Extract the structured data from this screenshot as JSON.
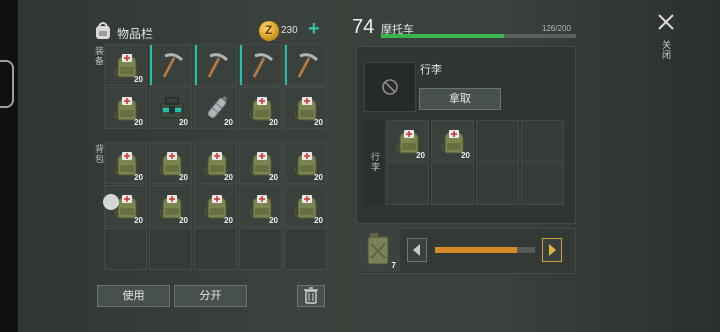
{
  "inventory": {
    "title": "物品栏",
    "coins": "230",
    "coin_glyph": "Z",
    "plus": "+",
    "side_label_top": "装备",
    "side_label_backpack": "背包",
    "use_label": "使用",
    "split_label": "分开",
    "equip_slots": [
      {
        "item": "backpack-icon",
        "qty": "20"
      },
      {
        "item": "pickaxe-icon",
        "qty": ""
      },
      {
        "item": "pickaxe-icon",
        "qty": ""
      },
      {
        "item": "pickaxe-icon",
        "qty": ""
      },
      {
        "item": "pickaxe-icon",
        "qty": ""
      },
      {
        "item": "backpack-icon",
        "qty": "20"
      },
      {
        "item": "toolbox-icon",
        "qty": "20"
      },
      {
        "item": "bottle-icon",
        "qty": "20"
      },
      {
        "item": "backpack-icon",
        "qty": "20"
      },
      {
        "item": "backpack-icon",
        "qty": "20"
      }
    ],
    "backpack_slots": [
      {
        "item": "backpack-icon",
        "qty": "20"
      },
      {
        "item": "backpack-icon",
        "qty": "20"
      },
      {
        "item": "backpack-icon",
        "qty": "20"
      },
      {
        "item": "backpack-icon",
        "qty": "20"
      },
      {
        "item": "backpack-icon",
        "qty": "20"
      },
      {
        "item": "backpack-icon",
        "qty": "20"
      },
      {
        "item": "backpack-icon",
        "qty": "20"
      },
      {
        "item": "backpack-icon",
        "qty": "20"
      },
      {
        "item": "backpack-icon",
        "qty": "20"
      },
      {
        "item": "backpack-icon",
        "qty": "20"
      },
      {
        "item": "",
        "qty": ""
      },
      {
        "item": "",
        "qty": ""
      },
      {
        "item": "",
        "qty": ""
      },
      {
        "item": "",
        "qty": ""
      },
      {
        "item": "",
        "qty": ""
      }
    ]
  },
  "vehicle": {
    "level": "74",
    "name": "摩托车",
    "capacity": "126/200",
    "capacity_fraction": 0.63,
    "luggage_title": "行李",
    "take_label": "拿取",
    "luggage_side_label": "行李",
    "luggage_slots": [
      {
        "item": "backpack-icon",
        "qty": "20"
      },
      {
        "item": "backpack-icon",
        "qty": "20"
      },
      {
        "item": "",
        "qty": ""
      },
      {
        "item": "",
        "qty": ""
      },
      {
        "item": "",
        "qty": ""
      },
      {
        "item": "",
        "qty": ""
      },
      {
        "item": "",
        "qty": ""
      },
      {
        "item": "",
        "qty": ""
      }
    ],
    "fuel_qty": "7",
    "fuel_fraction": 0.82
  },
  "close_label": "关闭",
  "colors": {
    "accent": "#2fc4a6",
    "capacity_bar": "#39b54a",
    "fuel_bar": "#d58a24"
  }
}
